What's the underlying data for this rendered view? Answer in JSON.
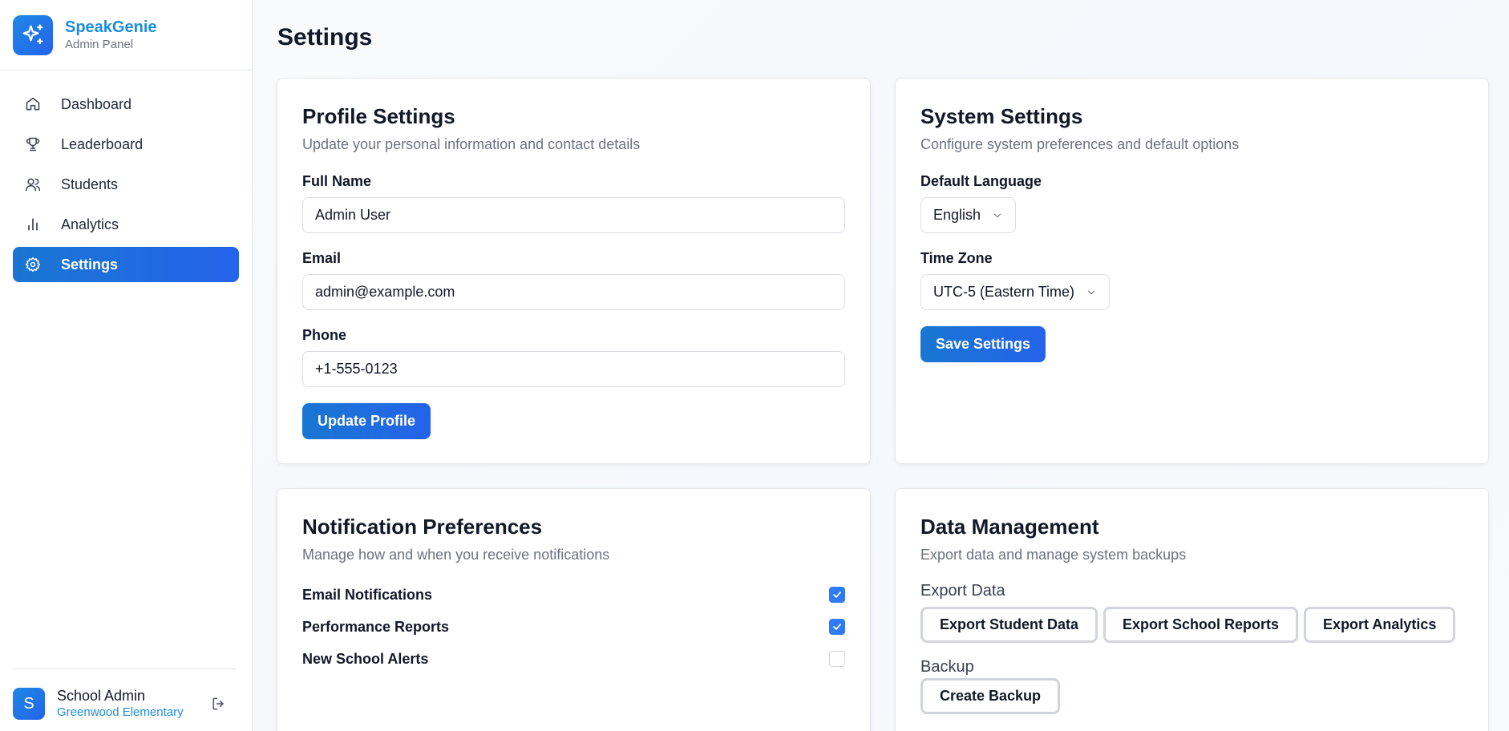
{
  "brand": {
    "name": "SpeakGenie",
    "subtitle": "Admin Panel",
    "logo_icon": "sparkles-icon"
  },
  "nav": {
    "items": [
      {
        "label": "Dashboard",
        "icon": "home-icon",
        "active": false
      },
      {
        "label": "Leaderboard",
        "icon": "trophy-icon",
        "active": false
      },
      {
        "label": "Students",
        "icon": "users-icon",
        "active": false
      },
      {
        "label": "Analytics",
        "icon": "bar-chart-icon",
        "active": false
      },
      {
        "label": "Settings",
        "icon": "gear-icon",
        "active": true
      }
    ]
  },
  "user": {
    "initial": "S",
    "name": "School Admin",
    "school": "Greenwood Elementary"
  },
  "page": {
    "title": "Settings"
  },
  "profile": {
    "title": "Profile Settings",
    "description": "Update your personal information and contact details",
    "full_name_label": "Full Name",
    "full_name_value": "Admin User",
    "email_label": "Email",
    "email_value": "admin@example.com",
    "phone_label": "Phone",
    "phone_value": "+1-555-0123",
    "button": "Update Profile"
  },
  "system": {
    "title": "System Settings",
    "description": "Configure system preferences and default options",
    "language_label": "Default Language",
    "language_value": "English",
    "timezone_label": "Time Zone",
    "timezone_value": "UTC-5 (Eastern Time)",
    "button": "Save Settings"
  },
  "notifications": {
    "title": "Notification Preferences",
    "description": "Manage how and when you receive notifications",
    "items": [
      {
        "label": "Email Notifications",
        "checked": true
      },
      {
        "label": "Performance Reports",
        "checked": true
      },
      {
        "label": "New School Alerts",
        "checked": false
      }
    ]
  },
  "data_management": {
    "title": "Data Management",
    "description": "Export data and manage system backups",
    "export_label": "Export Data",
    "export_buttons": [
      "Export Student Data",
      "Export School Reports",
      "Export Analytics"
    ],
    "backup_label": "Backup",
    "backup_button": "Create Backup"
  },
  "colors": {
    "accent": "#2563eb",
    "brand": "#1d8ce0",
    "checkbox": "#2f7bf5"
  }
}
